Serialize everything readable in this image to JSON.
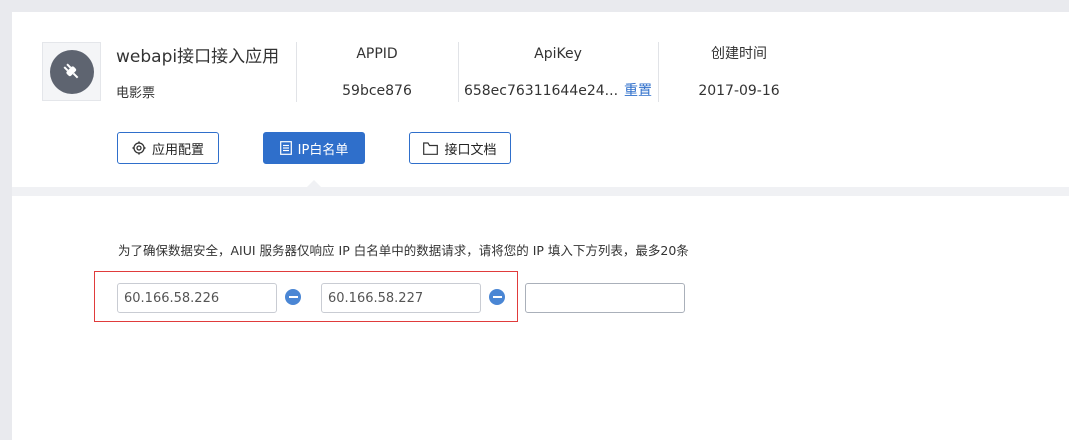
{
  "app": {
    "name": "webapi接口接入应用",
    "subtitle": "电影票",
    "icon": "plug-icon"
  },
  "meta": [
    {
      "label": "APPID",
      "value": "59bce876"
    },
    {
      "label": "ApiKey",
      "value": "658ec76311644e24...",
      "action": "重置"
    },
    {
      "label": "创建时间",
      "value": "2017-09-16"
    }
  ],
  "tabs": [
    {
      "label": "应用配置",
      "icon": "gear-icon",
      "active": false
    },
    {
      "label": "IP白名单",
      "icon": "list-icon",
      "active": true
    },
    {
      "label": "接口文档",
      "icon": "folder-icon",
      "active": false
    }
  ],
  "whitelist": {
    "notice": "为了确保数据安全，AIUI 服务器仅响应 IP 白名单中的数据请求，请将您的 IP 填入下方列表，最多20条",
    "entries": [
      "60.166.58.226",
      "60.166.58.227"
    ],
    "new_entry_value": ""
  },
  "colors": {
    "accent": "#2f6fcb",
    "highlight_border": "#e03b3b",
    "icon_bg": "#5e6470"
  }
}
